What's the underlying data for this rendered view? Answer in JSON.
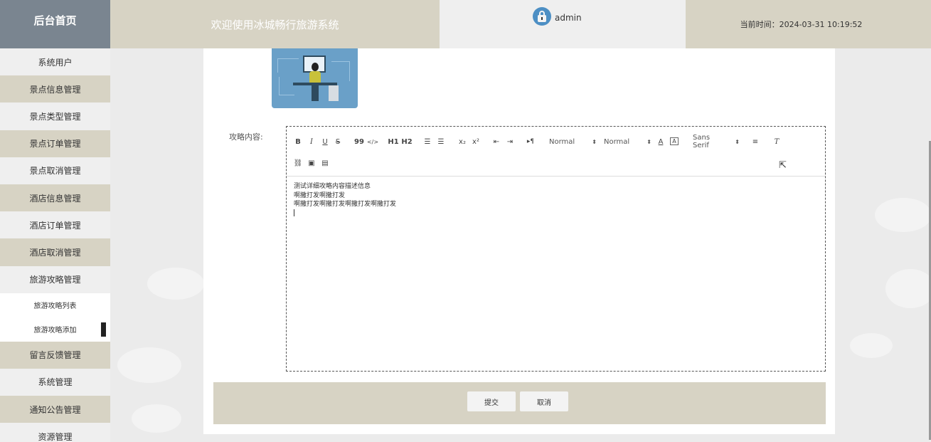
{
  "header": {
    "brand": "后台首页",
    "welcome": "欢迎使用冰城畅行旅游系统",
    "username": "admin",
    "time_label": "当前时间：",
    "time_value": "2024-03-31 10:19:52"
  },
  "sidebar": {
    "items": [
      {
        "label": "系统用户"
      },
      {
        "label": "景点信息管理"
      },
      {
        "label": "景点类型管理"
      },
      {
        "label": "景点订单管理"
      },
      {
        "label": "景点取消管理"
      },
      {
        "label": "酒店信息管理"
      },
      {
        "label": "酒店订单管理"
      },
      {
        "label": "酒店取消管理"
      },
      {
        "label": "旅游攻略管理"
      }
    ],
    "subitems": [
      {
        "label": "旅游攻略列表"
      },
      {
        "label": "旅游攻略添加"
      }
    ],
    "items_after": [
      {
        "label": "留言反馈管理"
      },
      {
        "label": "系统管理"
      },
      {
        "label": "通知公告管理"
      },
      {
        "label": "资源管理"
      }
    ]
  },
  "form": {
    "content_label": "攻略内容:",
    "toolbar": {
      "bold": "B",
      "italic": "I",
      "underline": "U",
      "strike": "S",
      "blockquote": "99",
      "code": "</>",
      "h1": "H1",
      "h2": "H2",
      "subscript": "x₂",
      "superscript": "x²",
      "size_select": "Normal",
      "header_select": "Normal",
      "font_select": "Sans Serif",
      "text_direction": "▸¶"
    },
    "content_lines": [
      "测试详细攻略内容描述信息",
      "啊撒打发啊撒打发",
      "啊撒打发啊撒打发啊撒打发啊撒打发"
    ],
    "submit_label": "提交",
    "cancel_label": "取消"
  },
  "colors": {
    "brand_bg": "#7a8590",
    "tan": "#d7d3c4",
    "light": "#efefef"
  }
}
